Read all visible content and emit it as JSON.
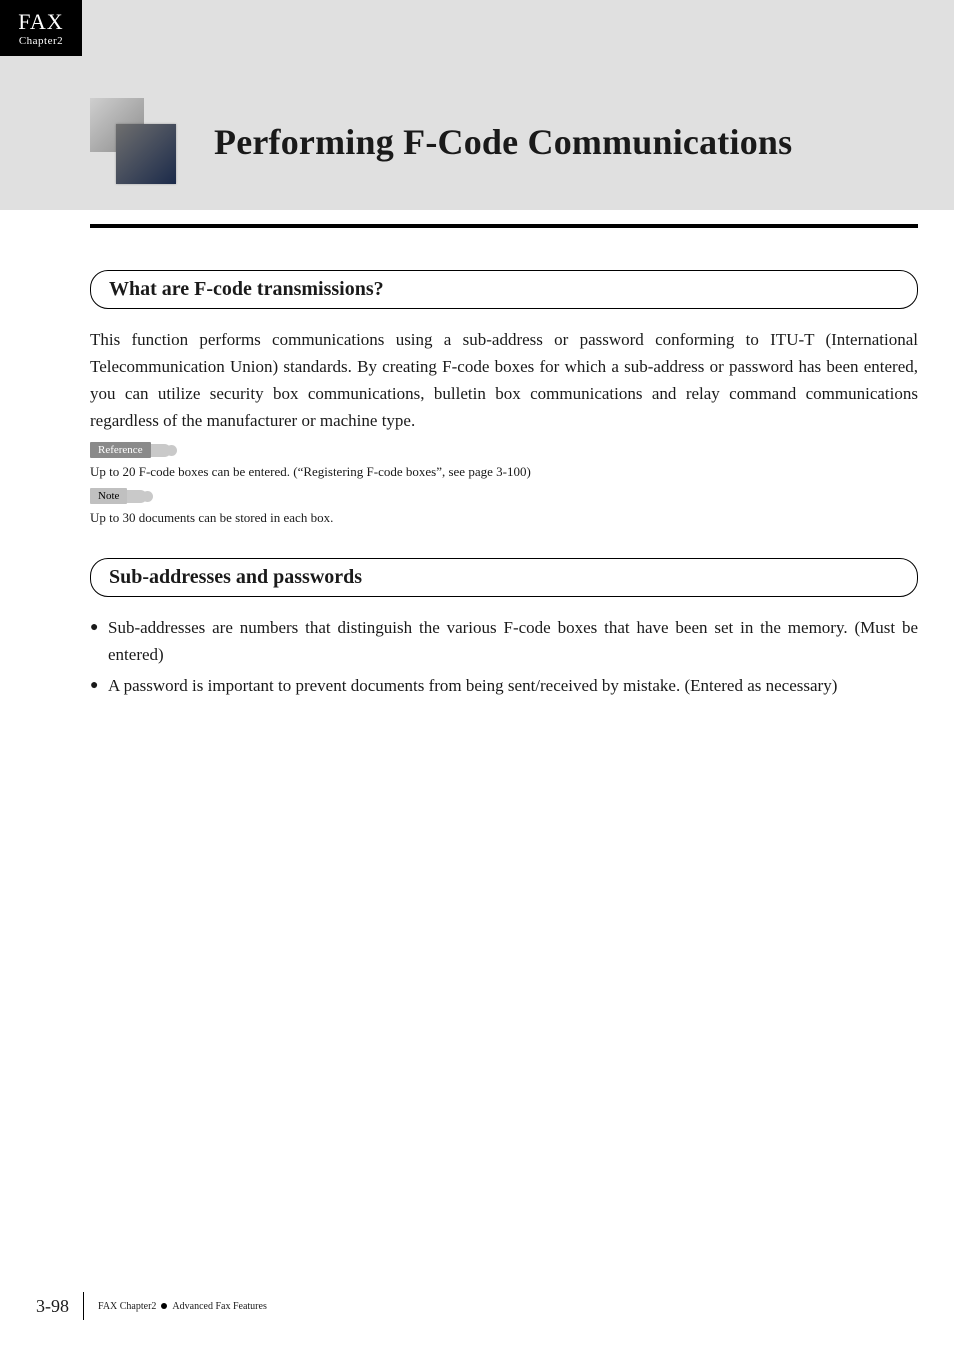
{
  "chapter_tab": {
    "line1": "FAX",
    "line2": "Chapter2"
  },
  "header": {
    "title": "Performing F-Code Communications"
  },
  "sections": {
    "s1": {
      "heading": "What are F-code transmissions?",
      "body": "This function performs communications using a sub-address or password conforming to ITU-T (International Telecommunication Union) standards. By creating F-code boxes for which a sub-address or password has been entered, you can utilize security box communications, bulletin box communications and relay command communications regardless of the manufacturer or machine type.",
      "reference_label": "Reference",
      "reference_text": "Up to 20 F-code boxes can be entered. (“Registering F-code boxes”, see page 3-100)",
      "note_label": "Note",
      "note_text": "Up to 30 documents can be stored in each box."
    },
    "s2": {
      "heading": "Sub-addresses and passwords",
      "bullets": [
        "Sub-addresses are numbers that distinguish the various F-code boxes that have been set in the memory. (Must be entered)",
        "A password is important to prevent documents from being sent/received by mistake. (Entered as necessary)"
      ]
    }
  },
  "footer": {
    "page_number": "3-98",
    "breadcrumb_left": "FAX Chapter2",
    "breadcrumb_right": "Advanced Fax Features"
  }
}
